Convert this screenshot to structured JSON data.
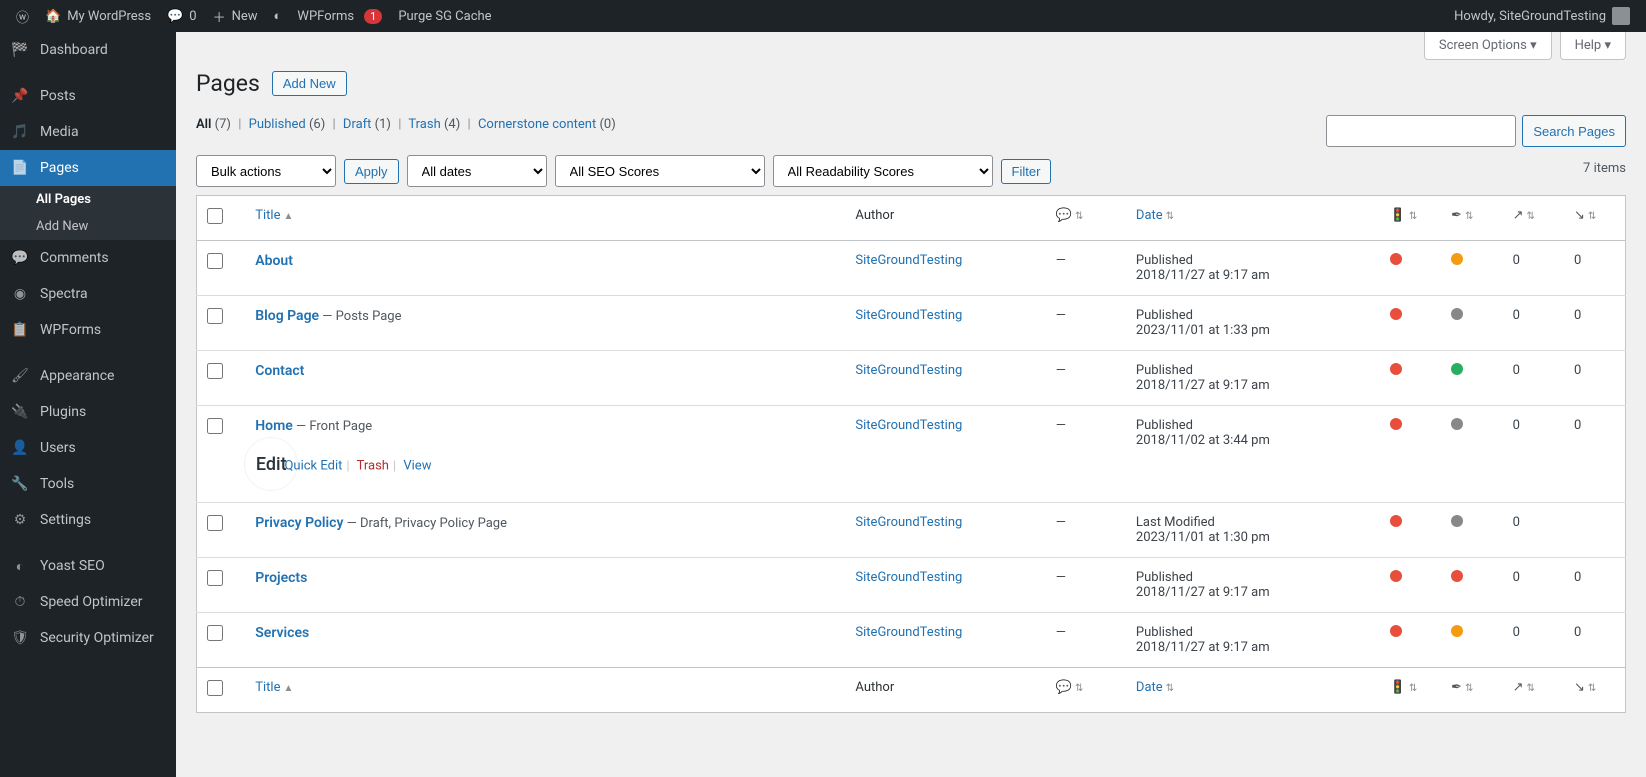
{
  "adminBar": {
    "siteName": "My WordPress",
    "commentCount": "0",
    "newLabel": "New",
    "wpformsLabel": "WPForms",
    "wpformsBadge": "1",
    "purgeLabel": "Purge SG Cache",
    "howdy": "Howdy, SiteGroundTesting"
  },
  "sidebar": {
    "dashboard": "Dashboard",
    "posts": "Posts",
    "media": "Media",
    "pages": "Pages",
    "allPages": "All Pages",
    "addNew": "Add New",
    "comments": "Comments",
    "spectra": "Spectra",
    "wpforms": "WPForms",
    "appearance": "Appearance",
    "plugins": "Plugins",
    "users": "Users",
    "tools": "Tools",
    "settings": "Settings",
    "yoast": "Yoast SEO",
    "speed": "Speed Optimizer",
    "security": "Security Optimizer"
  },
  "screenMeta": {
    "options": "Screen Options",
    "help": "Help"
  },
  "page": {
    "title": "Pages",
    "addNew": "Add New"
  },
  "views": {
    "all": "All",
    "allCount": "(7)",
    "published": "Published",
    "publishedCount": "(6)",
    "draft": "Draft",
    "draftCount": "(1)",
    "trash": "Trash",
    "trashCount": "(4)",
    "cornerstone": "Cornerstone content",
    "cornerstoneCount": "(0)"
  },
  "filters": {
    "bulk": "Bulk actions",
    "apply": "Apply",
    "dates": "All dates",
    "seo": "All SEO Scores",
    "readability": "All Readability Scores",
    "filterBtn": "Filter",
    "searchBtn": "Search Pages",
    "itemCount": "7 items"
  },
  "columns": {
    "title": "Title",
    "author": "Author",
    "date": "Date"
  },
  "rowActions": {
    "edit": "Edit",
    "quickEdit": "Quick Edit",
    "trash": "Trash",
    "view": "View"
  },
  "rows": [
    {
      "title": "About",
      "state": "",
      "author": "SiteGroundTesting",
      "comments": "—",
      "status": "Published",
      "date": "2018/11/27 at 9:17 am",
      "seo": "red",
      "read": "orange",
      "links": "0",
      "linked": "0",
      "actions": false
    },
    {
      "title": "Blog Page",
      "state": " — Posts Page",
      "author": "SiteGroundTesting",
      "comments": "—",
      "status": "Published",
      "date": "2023/11/01 at 1:33 pm",
      "seo": "red",
      "read": "gray",
      "links": "0",
      "linked": "0",
      "actions": false
    },
    {
      "title": "Contact",
      "state": "",
      "author": "SiteGroundTesting",
      "comments": "—",
      "status": "Published",
      "date": "2018/11/27 at 9:17 am",
      "seo": "red",
      "read": "green",
      "links": "0",
      "linked": "0",
      "actions": false
    },
    {
      "title": "Home",
      "state": " — Front Page",
      "author": "SiteGroundTesting",
      "comments": "—",
      "status": "Published",
      "date": "2018/11/02 at 3:44 pm",
      "seo": "red",
      "read": "gray",
      "links": "0",
      "linked": "0",
      "actions": true
    },
    {
      "title": "Privacy Policy",
      "state": " — Draft, Privacy Policy Page",
      "author": "SiteGroundTesting",
      "comments": "—",
      "status": "Last Modified",
      "date": "2023/11/01 at 1:30 pm",
      "seo": "red",
      "read": "gray",
      "links": "0",
      "linked": "",
      "actions": false
    },
    {
      "title": "Projects",
      "state": "",
      "author": "SiteGroundTesting",
      "comments": "—",
      "status": "Published",
      "date": "2018/11/27 at 9:17 am",
      "seo": "red",
      "read": "red",
      "links": "0",
      "linked": "0",
      "actions": false
    },
    {
      "title": "Services",
      "state": "",
      "author": "SiteGroundTesting",
      "comments": "—",
      "status": "Published",
      "date": "2018/11/27 at 9:17 am",
      "seo": "red",
      "read": "orange",
      "links": "0",
      "linked": "0",
      "actions": false
    }
  ]
}
